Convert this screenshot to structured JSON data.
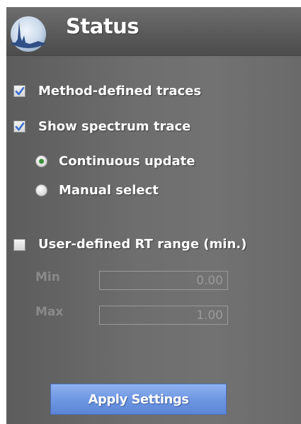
{
  "header": {
    "title": "Status",
    "icon": "spectrum-peak-icon"
  },
  "options": {
    "method_traces": {
      "label": "Method-defined traces",
      "checked": true
    },
    "spectrum_trace": {
      "label": "Show spectrum trace",
      "checked": true
    },
    "continuous_update": {
      "label": "Continuous update",
      "selected": true
    },
    "manual_select": {
      "label": "Manual select",
      "selected": false
    },
    "rt_range": {
      "label": "User-defined RT range (min.)",
      "checked": false
    }
  },
  "range": {
    "min_label": "Min",
    "min_value": "0.00",
    "max_label": "Max",
    "max_value": "1.00"
  },
  "apply_button": {
    "label": "Apply Settings"
  },
  "colors": {
    "panel": "#6a6a6a",
    "check": "#3b6fd0",
    "radio_selected": "#3d8d3a",
    "button": "#7aa2e8"
  }
}
